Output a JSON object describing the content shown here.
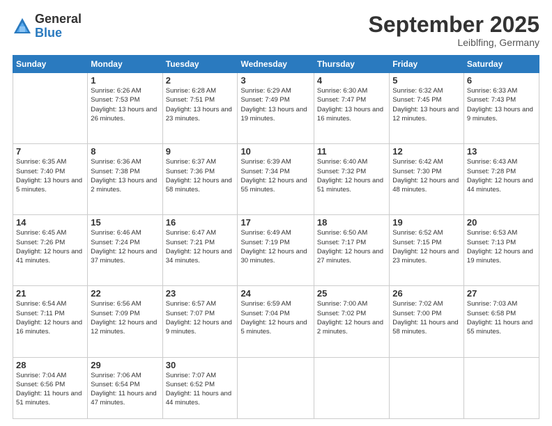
{
  "logo": {
    "general": "General",
    "blue": "Blue"
  },
  "header": {
    "month": "September 2025",
    "location": "Leiblfing, Germany"
  },
  "days_of_week": [
    "Sunday",
    "Monday",
    "Tuesday",
    "Wednesday",
    "Thursday",
    "Friday",
    "Saturday"
  ],
  "weeks": [
    [
      {
        "day": "",
        "info": ""
      },
      {
        "day": "1",
        "info": "Sunrise: 6:26 AM\nSunset: 7:53 PM\nDaylight: 13 hours and 26 minutes."
      },
      {
        "day": "2",
        "info": "Sunrise: 6:28 AM\nSunset: 7:51 PM\nDaylight: 13 hours and 23 minutes."
      },
      {
        "day": "3",
        "info": "Sunrise: 6:29 AM\nSunset: 7:49 PM\nDaylight: 13 hours and 19 minutes."
      },
      {
        "day": "4",
        "info": "Sunrise: 6:30 AM\nSunset: 7:47 PM\nDaylight: 13 hours and 16 minutes."
      },
      {
        "day": "5",
        "info": "Sunrise: 6:32 AM\nSunset: 7:45 PM\nDaylight: 13 hours and 12 minutes."
      },
      {
        "day": "6",
        "info": "Sunrise: 6:33 AM\nSunset: 7:43 PM\nDaylight: 13 hours and 9 minutes."
      }
    ],
    [
      {
        "day": "7",
        "info": "Sunrise: 6:35 AM\nSunset: 7:40 PM\nDaylight: 13 hours and 5 minutes."
      },
      {
        "day": "8",
        "info": "Sunrise: 6:36 AM\nSunset: 7:38 PM\nDaylight: 13 hours and 2 minutes."
      },
      {
        "day": "9",
        "info": "Sunrise: 6:37 AM\nSunset: 7:36 PM\nDaylight: 12 hours and 58 minutes."
      },
      {
        "day": "10",
        "info": "Sunrise: 6:39 AM\nSunset: 7:34 PM\nDaylight: 12 hours and 55 minutes."
      },
      {
        "day": "11",
        "info": "Sunrise: 6:40 AM\nSunset: 7:32 PM\nDaylight: 12 hours and 51 minutes."
      },
      {
        "day": "12",
        "info": "Sunrise: 6:42 AM\nSunset: 7:30 PM\nDaylight: 12 hours and 48 minutes."
      },
      {
        "day": "13",
        "info": "Sunrise: 6:43 AM\nSunset: 7:28 PM\nDaylight: 12 hours and 44 minutes."
      }
    ],
    [
      {
        "day": "14",
        "info": "Sunrise: 6:45 AM\nSunset: 7:26 PM\nDaylight: 12 hours and 41 minutes."
      },
      {
        "day": "15",
        "info": "Sunrise: 6:46 AM\nSunset: 7:24 PM\nDaylight: 12 hours and 37 minutes."
      },
      {
        "day": "16",
        "info": "Sunrise: 6:47 AM\nSunset: 7:21 PM\nDaylight: 12 hours and 34 minutes."
      },
      {
        "day": "17",
        "info": "Sunrise: 6:49 AM\nSunset: 7:19 PM\nDaylight: 12 hours and 30 minutes."
      },
      {
        "day": "18",
        "info": "Sunrise: 6:50 AM\nSunset: 7:17 PM\nDaylight: 12 hours and 27 minutes."
      },
      {
        "day": "19",
        "info": "Sunrise: 6:52 AM\nSunset: 7:15 PM\nDaylight: 12 hours and 23 minutes."
      },
      {
        "day": "20",
        "info": "Sunrise: 6:53 AM\nSunset: 7:13 PM\nDaylight: 12 hours and 19 minutes."
      }
    ],
    [
      {
        "day": "21",
        "info": "Sunrise: 6:54 AM\nSunset: 7:11 PM\nDaylight: 12 hours and 16 minutes."
      },
      {
        "day": "22",
        "info": "Sunrise: 6:56 AM\nSunset: 7:09 PM\nDaylight: 12 hours and 12 minutes."
      },
      {
        "day": "23",
        "info": "Sunrise: 6:57 AM\nSunset: 7:07 PM\nDaylight: 12 hours and 9 minutes."
      },
      {
        "day": "24",
        "info": "Sunrise: 6:59 AM\nSunset: 7:04 PM\nDaylight: 12 hours and 5 minutes."
      },
      {
        "day": "25",
        "info": "Sunrise: 7:00 AM\nSunset: 7:02 PM\nDaylight: 12 hours and 2 minutes."
      },
      {
        "day": "26",
        "info": "Sunrise: 7:02 AM\nSunset: 7:00 PM\nDaylight: 11 hours and 58 minutes."
      },
      {
        "day": "27",
        "info": "Sunrise: 7:03 AM\nSunset: 6:58 PM\nDaylight: 11 hours and 55 minutes."
      }
    ],
    [
      {
        "day": "28",
        "info": "Sunrise: 7:04 AM\nSunset: 6:56 PM\nDaylight: 11 hours and 51 minutes."
      },
      {
        "day": "29",
        "info": "Sunrise: 7:06 AM\nSunset: 6:54 PM\nDaylight: 11 hours and 47 minutes."
      },
      {
        "day": "30",
        "info": "Sunrise: 7:07 AM\nSunset: 6:52 PM\nDaylight: 11 hours and 44 minutes."
      },
      {
        "day": "",
        "info": ""
      },
      {
        "day": "",
        "info": ""
      },
      {
        "day": "",
        "info": ""
      },
      {
        "day": "",
        "info": ""
      }
    ]
  ]
}
